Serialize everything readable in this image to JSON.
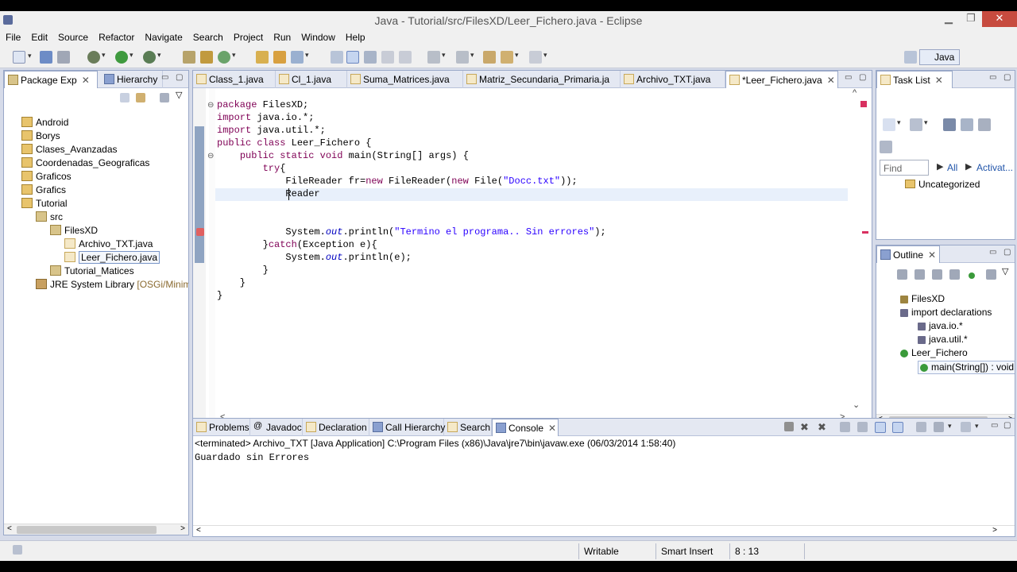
{
  "window": {
    "title": "Java - Tutorial/src/FilesXD/Leer_Fichero.java - Eclipse",
    "minimize": "▁",
    "restore": "❐",
    "close": "✕"
  },
  "menu": [
    "File",
    "Edit",
    "Source",
    "Refactor",
    "Navigate",
    "Search",
    "Project",
    "Run",
    "Window",
    "Help"
  ],
  "perspective": {
    "label": "Java"
  },
  "left_views": {
    "tab1": "Package Exp",
    "tab2": "Hierarchy"
  },
  "package_tree": [
    {
      "label": "Android",
      "indent": 0,
      "icon": "project-icon"
    },
    {
      "label": "Borys",
      "indent": 0,
      "icon": "project-icon"
    },
    {
      "label": "Clases_Avanzadas",
      "indent": 0,
      "icon": "project-icon"
    },
    {
      "label": "Coordenadas_Geograficas",
      "indent": 0,
      "icon": "project-icon"
    },
    {
      "label": "Graficos",
      "indent": 0,
      "icon": "project-icon"
    },
    {
      "label": "Grafics",
      "indent": 0,
      "icon": "project-icon"
    },
    {
      "label": "Tutorial",
      "indent": 0,
      "icon": "project-icon"
    },
    {
      "label": "src",
      "indent": 1,
      "icon": "source-folder-icon"
    },
    {
      "label": "FilesXD",
      "indent": 2,
      "icon": "package-icon"
    },
    {
      "label": "Archivo_TXT.java",
      "indent": 3,
      "icon": "java-file-icon"
    },
    {
      "label": "Leer_Fichero.java",
      "indent": 3,
      "icon": "java-file-icon",
      "selected": true
    },
    {
      "label": "Tutorial_Matices",
      "indent": 2,
      "icon": "package-icon"
    },
    {
      "label": "JRE System Library",
      "suffix": " [OSGi/Minimum",
      "indent": 1,
      "icon": "library-icon"
    }
  ],
  "editor_tabs": [
    {
      "label": "Class_1.java"
    },
    {
      "label": "Cl_1.java"
    },
    {
      "label": "Suma_Matrices.java"
    },
    {
      "label": "Matriz_Secundaria_Primaria.ja"
    },
    {
      "label": "Archivo_TXT.java"
    },
    {
      "label": "*Leer_Fichero.java",
      "active": true
    }
  ],
  "code": [
    "package FilesXD;",
    "import java.io.*;",
    "import java.util.*;",
    "public class Leer_Fichero {",
    "    public static void main(String[] args) {",
    "        try{",
    "            FileReader fr=new FileReader(new File(\"Docc.txt\"));",
    "            Reader",
    "",
    "",
    "            System.out.println(\"Termino el programa.. Sin errores\");",
    "        }catch(Exception e){",
    "            System.out.println(e);",
    "        }",
    "    }",
    "}"
  ],
  "task_list": {
    "title": "Task List",
    "find_placeholder": "Find",
    "all": "All",
    "activate": "Activat...",
    "category": "Uncategorized"
  },
  "outline": {
    "title": "Outline",
    "items": [
      {
        "label": "FilesXD",
        "indent": 0,
        "icon": "package-icon"
      },
      {
        "label": "import declarations",
        "indent": 0,
        "icon": "imports-icon"
      },
      {
        "label": "java.io.*",
        "indent": 1,
        "icon": "import-icon"
      },
      {
        "label": "java.util.*",
        "indent": 1,
        "icon": "import-icon"
      },
      {
        "label": "Leer_Fichero",
        "indent": 0,
        "icon": "class-icon"
      },
      {
        "label": "main(String[]) : void",
        "indent": 1,
        "icon": "method-icon",
        "selected": true
      }
    ]
  },
  "bottom_tabs": [
    {
      "label": "Problems"
    },
    {
      "label": "Javadoc"
    },
    {
      "label": "Declaration"
    },
    {
      "label": "Call Hierarchy"
    },
    {
      "label": "Search"
    },
    {
      "label": "Console",
      "active": true
    }
  ],
  "console": {
    "header": "<terminated> Archivo_TXT [Java Application] C:\\Program Files (x86)\\Java\\jre7\\bin\\javaw.exe (06/03/2014 1:58:40)",
    "output": "Guardado sin Errores"
  },
  "status": {
    "writable": "Writable",
    "insert_mode": "Smart Insert",
    "position": "8 : 13"
  },
  "colors": {
    "keyword": "#7f0055",
    "string": "#2a00ff",
    "static_field": "#0000c0",
    "selection_blue": "#3399ff"
  }
}
